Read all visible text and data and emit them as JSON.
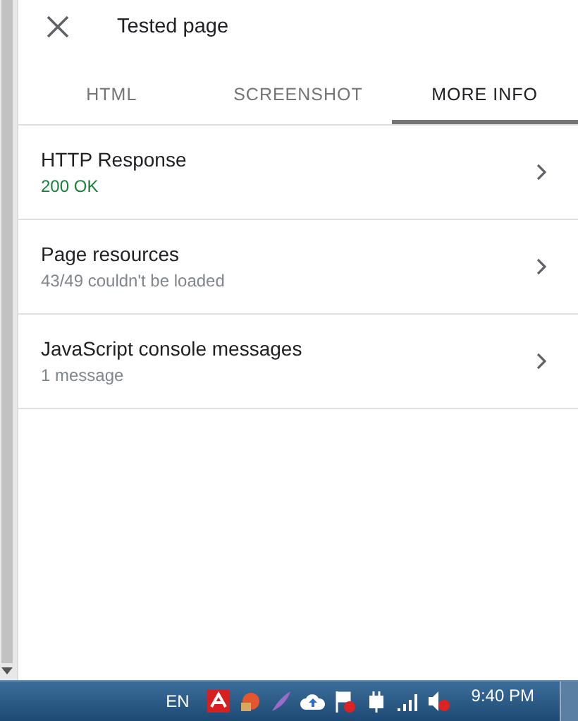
{
  "header": {
    "title": "Tested page"
  },
  "tabs": [
    {
      "label": "HTML",
      "selected": false
    },
    {
      "label": "SCREENSHOT",
      "selected": false
    },
    {
      "label": "MORE INFO",
      "selected": true
    }
  ],
  "items": [
    {
      "title": "HTTP Response",
      "subtitle": "200 OK",
      "color": "#188038"
    },
    {
      "title": "Page resources",
      "subtitle": "43/49 couldn't be loaded",
      "color": "#80868b"
    },
    {
      "title": "JavaScript console messages",
      "subtitle": "1 message",
      "color": "#80868b"
    }
  ],
  "taskbar": {
    "language": "EN",
    "time": "9:40 PM"
  }
}
